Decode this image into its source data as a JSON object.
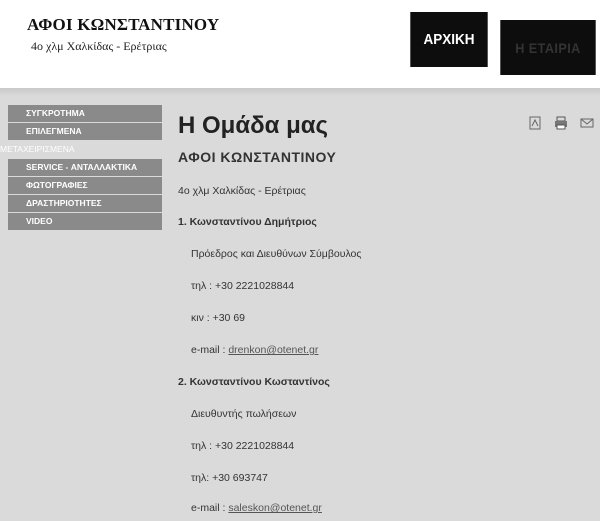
{
  "header": {
    "brand_title": "ΑΦΟΙ ΚΩΝΣΤΑΝΤΙΝΟΥ",
    "brand_subtitle": "4ο χλμ Χαλκίδας - Ερέτριας",
    "nav": [
      "ΑΡΧΙΚΗ",
      "Η ΕΤΑΙΡΙΑ"
    ]
  },
  "sidebar": {
    "items": [
      "ΣΥΓΚΡΟΤΗΜΑ",
      "ΕΠΙΛΕΓΜΕΝΑ",
      "ΜΕΤΑΧΕΙΡΙΣΜΕΝΑ",
      "SERVICE - ΑΝΤΑΛΛΑΚΤΙΚΑ",
      "ΦΩΤΟΓΡΑΦΙΕΣ",
      "ΔΡΑΣΤΗΡΙΟΤΗΤΕΣ",
      "VIDEO"
    ]
  },
  "content": {
    "title": "Η Ομάδα μας",
    "company": "ΑΦΟΙ ΚΩΝΣΤΑΝΤΙΝΟΥ",
    "address": "4ο χλμ Χαλκίδας - Ερέτριας",
    "person1": {
      "name": "1. Κωνσταντίνου Δημήτριος",
      "role": "Πρόεδρος και Διευθύνων Σύμβουλος",
      "phone": "τηλ : +30 2221028844",
      "mobile": "κιν : +30 69",
      "email_label": "e-mail : ",
      "email": "drenkon@otenet.gr"
    },
    "person2": {
      "name": "2. Κωνσταντίνου Κωσταντίνος",
      "role": "Διευθυντής πωλήσεων",
      "phone": "τηλ : +30 2221028844",
      "mobile": "τηλ: +30 693747",
      "email_label": "e-mail : ",
      "email": "saleskon@otenet.gr"
    }
  },
  "icons": [
    "pdf-icon",
    "print-icon",
    "email-icon"
  ]
}
